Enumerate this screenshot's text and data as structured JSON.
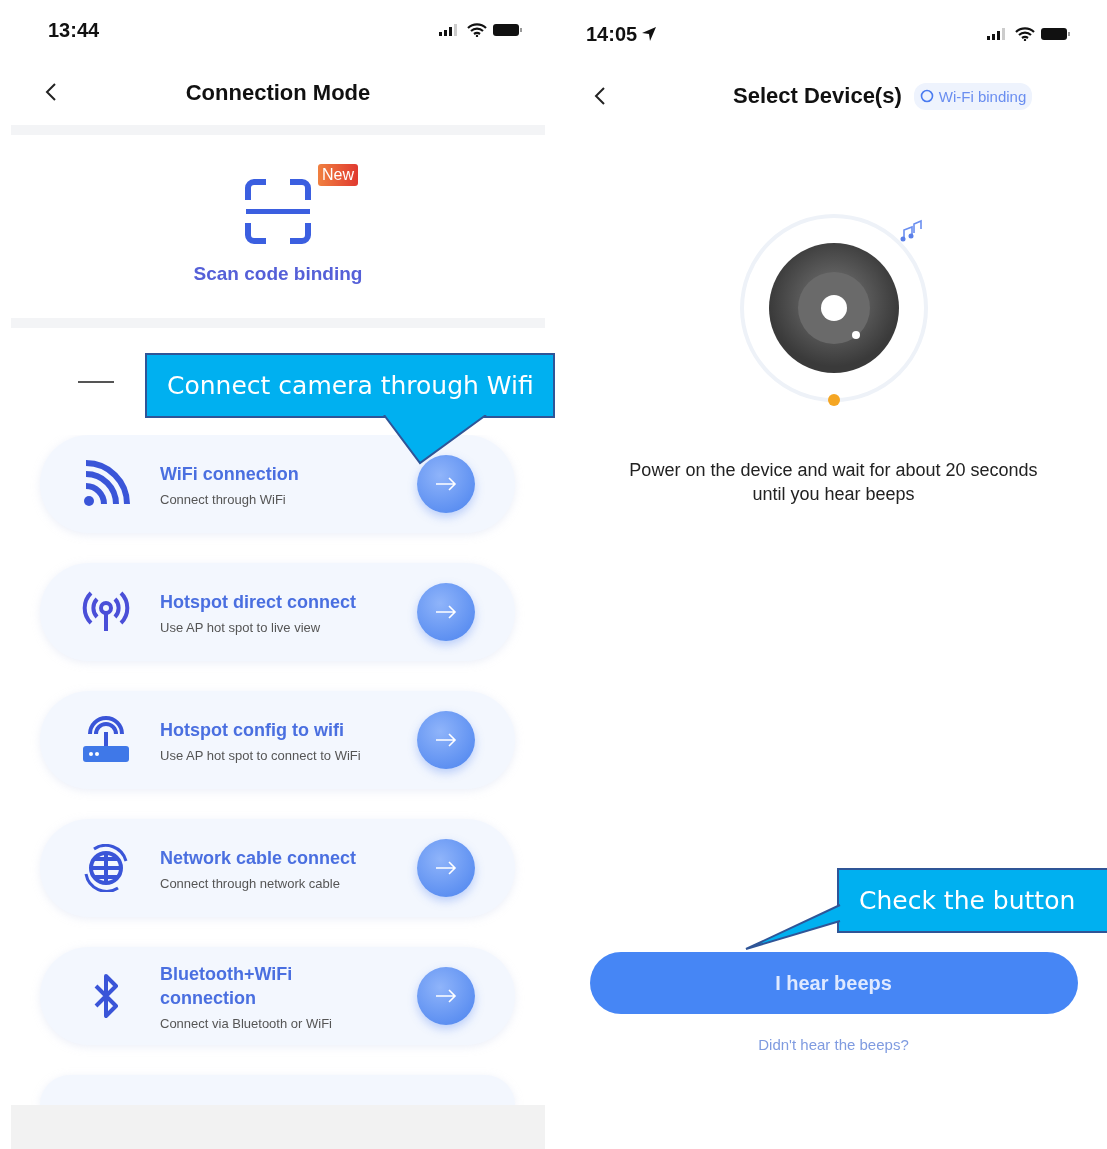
{
  "left_screen": {
    "status_bar": {
      "time": "13:44"
    },
    "nav": {
      "title": "Connection Mode"
    },
    "scan": {
      "label": "Scan code binding",
      "badge": "New"
    },
    "options": [
      {
        "kind": "wifi",
        "title": "WiFi connection",
        "subtitle": "Connect through WiFi"
      },
      {
        "kind": "hotspot",
        "title": "Hotspot direct connect",
        "subtitle": "Use AP hot spot to live view"
      },
      {
        "kind": "router",
        "title": "Hotspot config to wifi",
        "subtitle": "Use AP hot spot to connect to WiFi"
      },
      {
        "kind": "globe",
        "title": "Network cable connect",
        "subtitle": "Connect through network cable"
      },
      {
        "kind": "bluetooth",
        "title": "Bluetooth+WiFi connection",
        "subtitle": "Connect via Bluetooth or WiFi"
      }
    ],
    "callout": {
      "text": "Connect camera through Wifi"
    }
  },
  "right_screen": {
    "status_bar": {
      "time": "14:05"
    },
    "nav": {
      "title": "Select Device(s)",
      "pill": "Wi-Fi binding"
    },
    "instruction": "Power on the device and wait for about 20 seconds until you hear beeps",
    "primary_button": "I hear beeps",
    "link": "Didn't hear the beeps?",
    "callout": {
      "text": "Check the button"
    }
  }
}
